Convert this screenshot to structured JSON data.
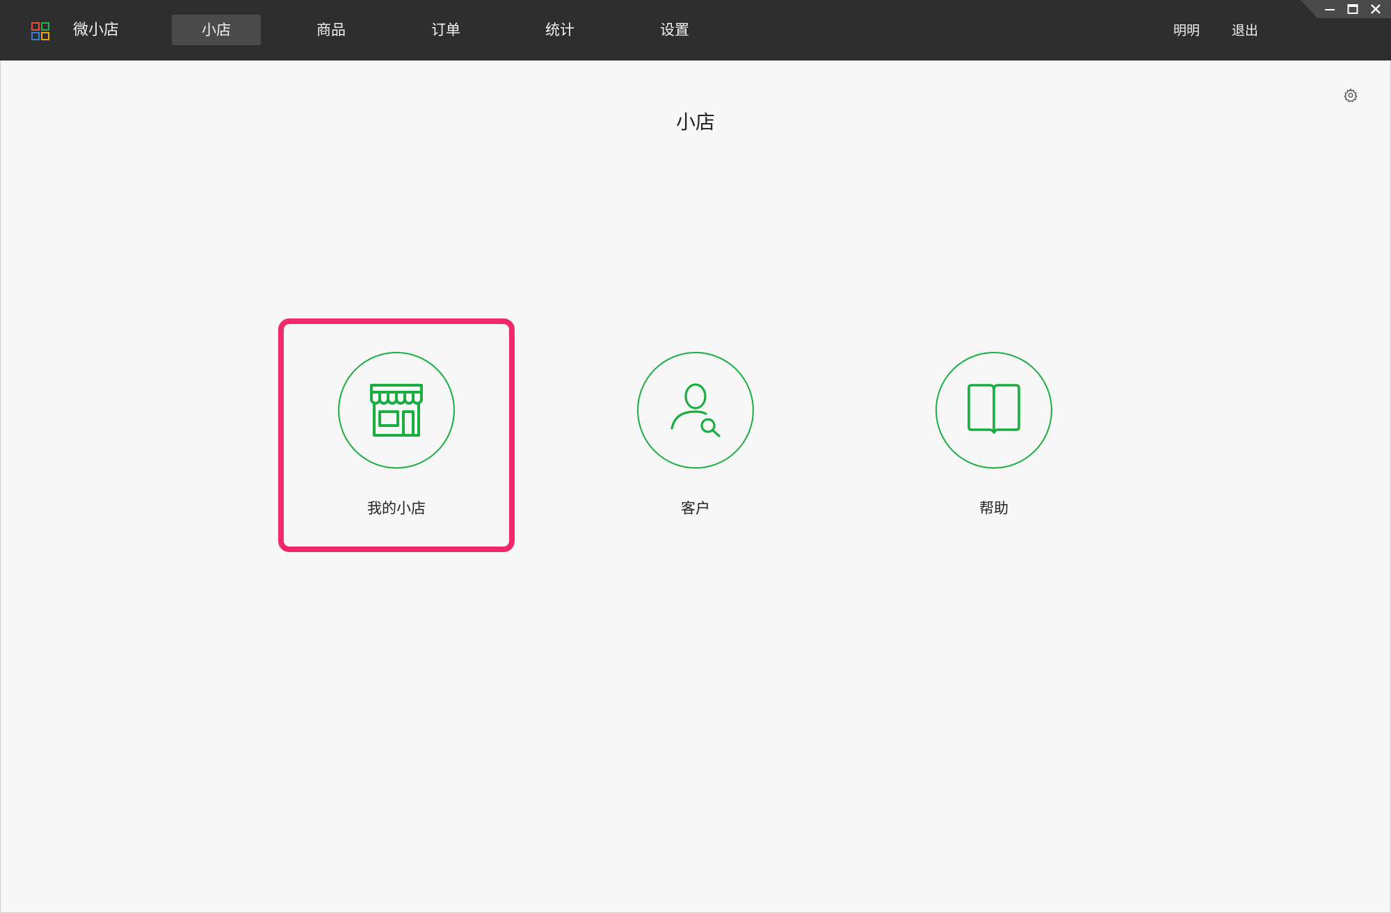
{
  "app": {
    "name": "微小店",
    "logo_icon": "grid-logo-icon"
  },
  "nav": {
    "tabs": [
      {
        "label": "小店",
        "active": true
      },
      {
        "label": "商品",
        "active": false
      },
      {
        "label": "订单",
        "active": false
      },
      {
        "label": "统计",
        "active": false
      },
      {
        "label": "设置",
        "active": false
      }
    ]
  },
  "user": {
    "name": "明明",
    "logout": "退出"
  },
  "window_controls": [
    "minimize-icon",
    "maximize-icon",
    "close-icon"
  ],
  "page": {
    "title": "小店",
    "settings_icon": "gear-icon"
  },
  "tiles": [
    {
      "label": "我的小店",
      "icon": "storefront-icon",
      "selected": true
    },
    {
      "label": "客户",
      "icon": "user-search-icon",
      "selected": false
    },
    {
      "label": "帮助",
      "icon": "open-book-icon",
      "selected": false
    }
  ],
  "colors": {
    "topbar": "#2e2e2e",
    "active_tab": "#4a4a4a",
    "accent_green": "#1aad3f",
    "highlight": "#f1286a",
    "background": "#f7f7f7"
  }
}
